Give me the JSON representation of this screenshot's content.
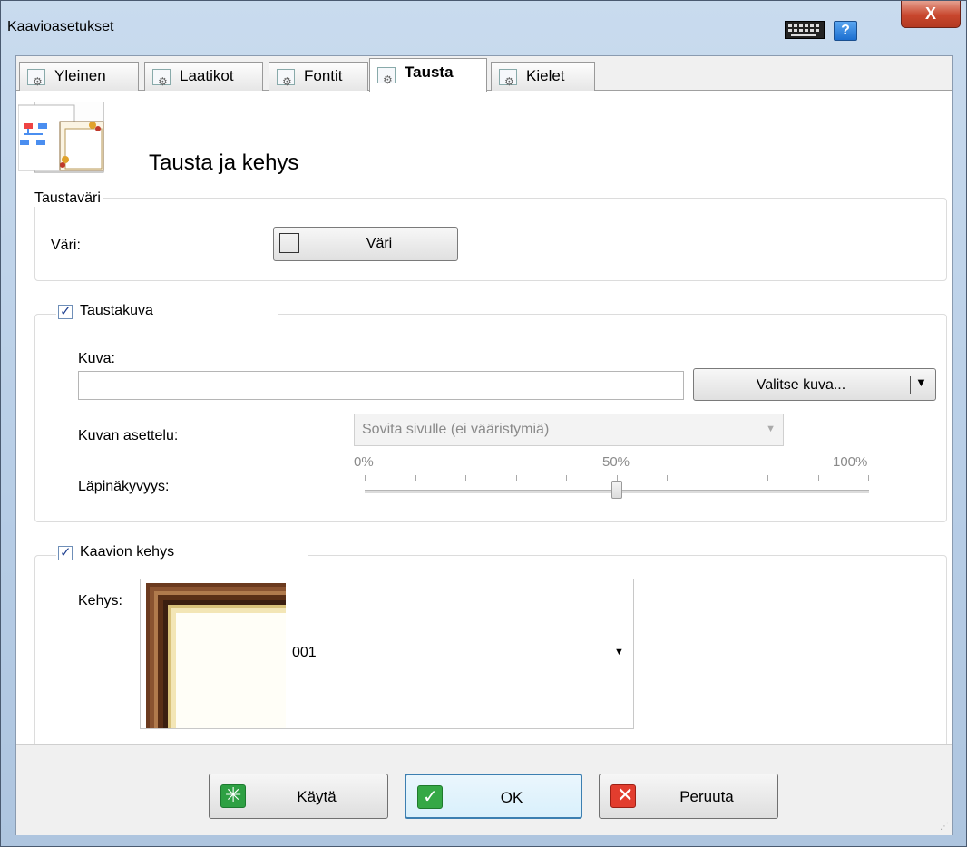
{
  "window": {
    "title": "Kaavioasetukset",
    "help_label": "?",
    "close_label": "X"
  },
  "tabs": [
    {
      "label": "Yleinen",
      "active": false
    },
    {
      "label": "Laatikot",
      "active": false
    },
    {
      "label": "Fontit",
      "active": false
    },
    {
      "label": "Tausta",
      "active": true
    },
    {
      "label": "Kielet",
      "active": false
    }
  ],
  "page": {
    "title": "Tausta ja kehys"
  },
  "background_color": {
    "group_title": "Taustaväri",
    "color_label": "Väri:",
    "color_button": "Väri",
    "color_value": "#ffffff"
  },
  "background_image": {
    "enabled": true,
    "group_title": "Taustakuva",
    "image_label": "Kuva:",
    "image_value": "",
    "choose_button": "Valitse kuva...",
    "layout_label": "Kuvan asettelu:",
    "layout_value": "Sovita sivulle (ei vääristymiä)",
    "transparency_label": "Läpinäkyvyys:",
    "transparency_ticks": [
      "0%",
      "50%",
      "100%"
    ],
    "transparency_value_percent": 50
  },
  "frame": {
    "enabled": true,
    "group_title": "Kaavion kehys",
    "frame_label": "Kehys:",
    "frame_value": "001"
  },
  "footer": {
    "apply_label": "Käytä",
    "ok_label": "OK",
    "cancel_label": "Peruuta"
  }
}
